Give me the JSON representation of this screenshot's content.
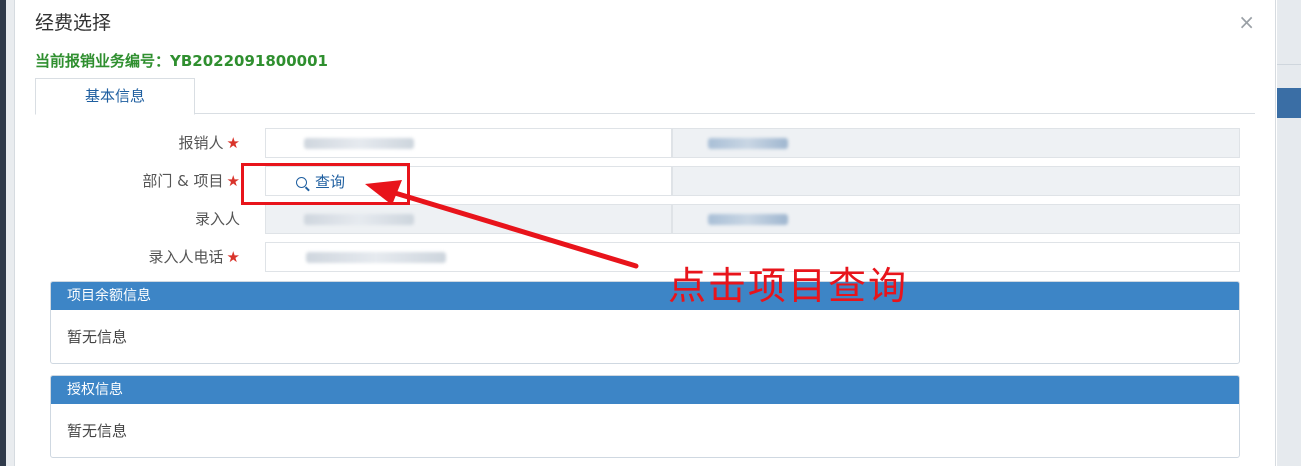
{
  "dialog": {
    "title": "经费选择",
    "close_label": "×",
    "business_number": "当前报销业务编号：YB2022091800001"
  },
  "tabs": [
    {
      "label": "基本信息",
      "active": true
    }
  ],
  "form": {
    "reimburser": {
      "label": "报销人",
      "required": true
    },
    "dept_project": {
      "label": "部门 & 项目",
      "required": true,
      "query_button": "查询"
    },
    "entered_by": {
      "label": "录入人",
      "required": false
    },
    "entered_phone": {
      "label": "录入人电话",
      "required": true
    },
    "required_mark": "★"
  },
  "panels": {
    "project_balance": {
      "title": "项目余额信息",
      "empty_text": "暂无信息"
    },
    "authorization": {
      "title": "授权信息",
      "empty_text": "暂无信息"
    }
  },
  "annotation": {
    "text": "点击项目查询",
    "color": "#e8141b"
  },
  "colors": {
    "accent_blue": "#3d85c6",
    "business_number_green": "#2f8f2f",
    "required_red": "#d9342b"
  },
  "icons": {
    "query": "search-icon",
    "close": "close-icon"
  }
}
